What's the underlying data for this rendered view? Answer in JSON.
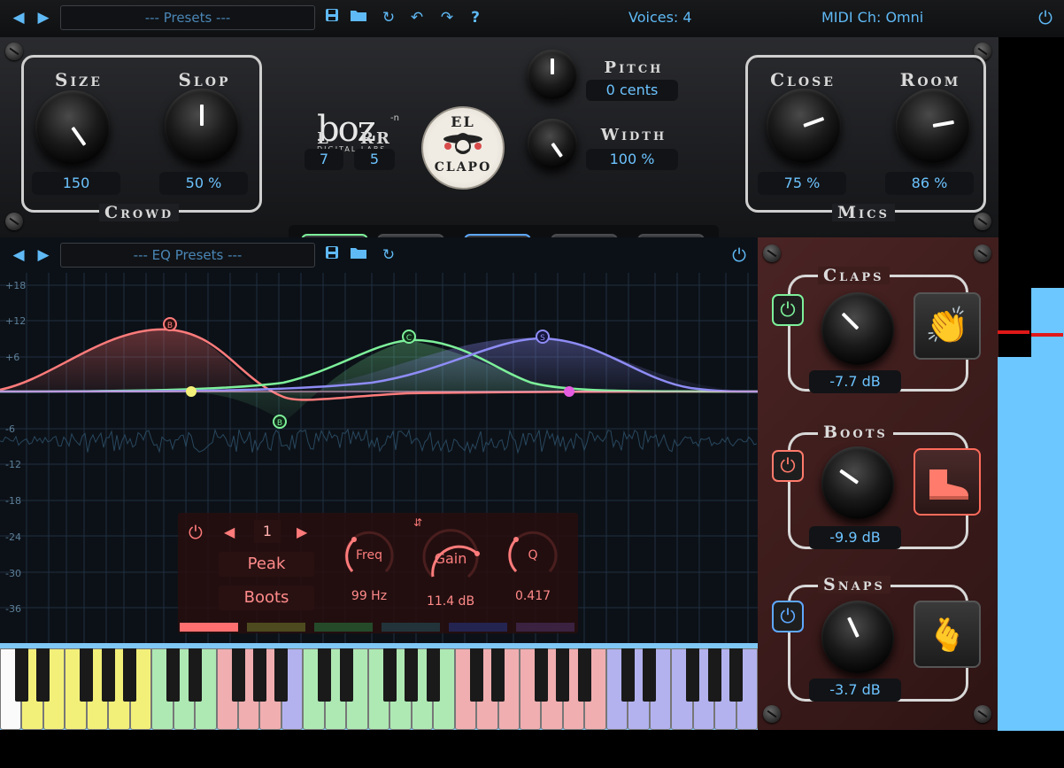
{
  "topbar": {
    "preset_label": "--- Presets ---",
    "voices_label": "Voices: 4",
    "midi_label": "MIDI Ch: Omni",
    "help_label": "?"
  },
  "crowd": {
    "title": "Crowd",
    "size_label": "Size",
    "size_value": "150",
    "slop_label": "Slop",
    "slop_value": "50 %"
  },
  "logo": {
    "brand": "boz",
    "superscript": "-n",
    "sub": "DIGITAL LABS",
    "badge_top": "EL",
    "badge_bottom": "CLAPO"
  },
  "lr": {
    "l_label": "L",
    "l_value": "7",
    "rr_label": "RR",
    "rr_value": "5"
  },
  "pitch": {
    "label": "Pitch",
    "value": "0 cents"
  },
  "width": {
    "label": "Width",
    "value": "100 %"
  },
  "mics": {
    "title": "Mics",
    "close_label": "Close",
    "close_value": "75 %",
    "room_label": "Room",
    "room_value": "86 %"
  },
  "eq": {
    "preset_label": "--- EQ Presets ---",
    "db_labels": [
      "+18",
      "+12",
      "+6",
      "-6",
      "-12",
      "-18",
      "-24",
      "-30",
      "-36"
    ],
    "nodes": [
      {
        "letter": "B",
        "color": "#ff7b7b"
      },
      {
        "letter": "C",
        "color": "#7df09a"
      },
      {
        "letter": "S",
        "color": "#8e8cf5"
      },
      {
        "letter": "B",
        "color": "#7df09a"
      }
    ],
    "band": {
      "number": "1",
      "type": "Peak",
      "target": "Boots",
      "freq_label": "Freq",
      "freq_value": "99 Hz",
      "gain_label": "Gain",
      "gain_value": "11.4 dB",
      "q_label": "Q",
      "q_value": "0.417",
      "tab_colors": [
        "#ff6f6f",
        "#4c4a1e",
        "#244a2a",
        "#22343a",
        "#242450",
        "#3a2240"
      ]
    }
  },
  "sidebar": {
    "claps": {
      "title": "Claps",
      "value": "-7.7 dB",
      "color": "#7df09a",
      "icon": "clap-hands-icon"
    },
    "boots": {
      "title": "Boots",
      "value": "-9.9 dB",
      "color": "#ff7b6b",
      "icon": "boot-icon"
    },
    "snaps": {
      "title": "Snaps",
      "value": "-3.7 dB",
      "color": "#5ea8ff",
      "icon": "finger-snap-icon"
    }
  },
  "meters": {
    "left_level": 0.73,
    "right_level": 0.92
  },
  "colors": {
    "accent": "#5fb9f5",
    "claps": "#7df09a",
    "boots": "#ff7b7b",
    "snaps": "#8e8cf5",
    "band_yellow": "#f3f07a"
  }
}
